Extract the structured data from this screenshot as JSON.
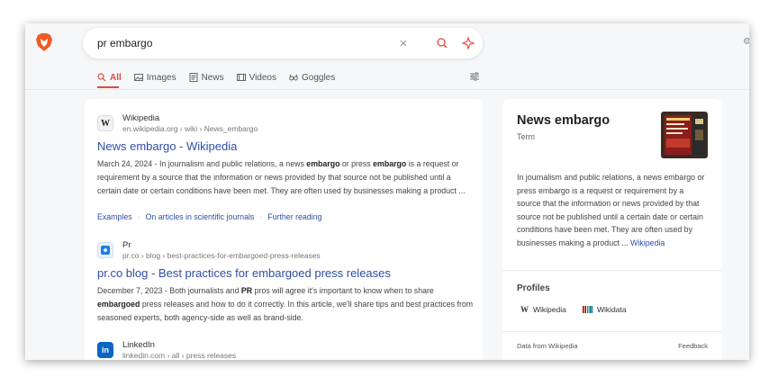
{
  "search": {
    "query": "pr embargo"
  },
  "tabs": [
    {
      "label": "All",
      "icon": "search-icon"
    },
    {
      "label": "Images",
      "icon": "image-icon"
    },
    {
      "label": "News",
      "icon": "news-icon"
    },
    {
      "label": "Videos",
      "icon": "video-icon"
    },
    {
      "label": "Goggles",
      "icon": "goggles-icon"
    }
  ],
  "results": [
    {
      "site": "Wikipedia",
      "url": "en.wikipedia.org › wiki › News_embargo",
      "title": "News embargo - Wikipedia",
      "date": "March 24, 2024",
      "desc_parts": [
        "In journalism and public relations, a news ",
        "embargo",
        " or press ",
        "embargo",
        " is a request or requirement by a source that the information or news provided by that source not be published until a certain date or certain conditions have been met. They are often used by businesses making a product ..."
      ],
      "links": [
        "Examples",
        "On articles in scientific journals",
        "Further reading"
      ]
    },
    {
      "site": "Pr",
      "url": "pr.co › blog › best-practices-for-embargoed-press-releases",
      "title": "pr.co blog - Best practices for embargoed press releases",
      "date": "December 7, 2023",
      "desc_parts": [
        "Both journalists and ",
        "PR",
        " pros will agree it's important to know when to share ",
        "embargoed",
        " press releases and how to do it correctly. In this article, we'll share tips and best practices from seasoned experts, both agency-side as well as brand-side."
      ]
    },
    {
      "site": "LinkedIn",
      "url": "linkedin.com › all › press releases"
    }
  ],
  "panel": {
    "title": "News embargo",
    "subtitle": "Term",
    "description": "In journalism and public relations, a news embargo or press embargo is a request or requirement by a source that the information or news provided by that source not be published until a certain date or certain conditions have been met. They are often used by businesses making a product ...",
    "more_link": "Wikipedia",
    "profiles_heading": "Profiles",
    "profiles": [
      "Wikipedia",
      "Wikidata"
    ],
    "footer_source": "Data from Wikipedia",
    "footer_feedback": "Feedback"
  },
  "colors": {
    "accent": "#e2483d",
    "link": "#2e4da8"
  }
}
